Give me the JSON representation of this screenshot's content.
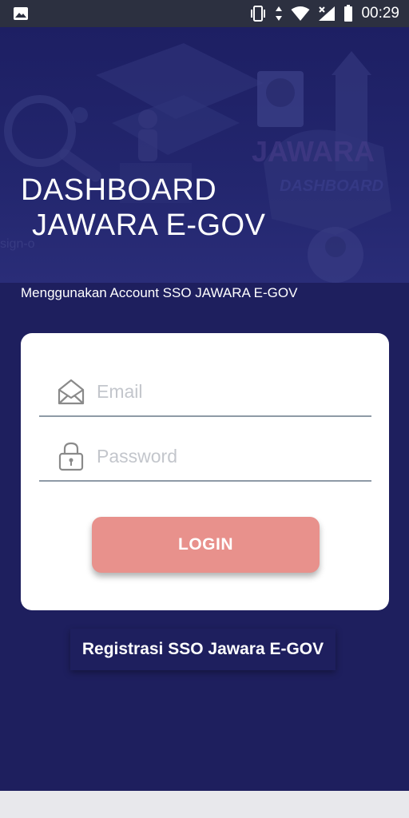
{
  "status_bar": {
    "time": "00:29",
    "icons": [
      "image-notification-icon",
      "vibrate-icon",
      "data-arrows-icon",
      "wifi-icon",
      "signal-icon",
      "battery-icon"
    ]
  },
  "hero": {
    "title_line1": "DASHBOARD",
    "title_line2": "JAWARA E-GOV",
    "background_art": [
      "magnifier-illustration",
      "building-illustration",
      "person-avatar-illustration",
      "jawara-dashboard-logo"
    ]
  },
  "subtitle": "Menggunakan Account SSO JAWARA E-GOV",
  "login_form": {
    "email_placeholder": "Email",
    "email_value": "",
    "email_icon": "envelope-icon",
    "password_placeholder": "Password",
    "password_value": "",
    "password_icon": "lock-icon",
    "login_label": "LOGIN"
  },
  "register_label": "Registrasi SSO Jawara E-GOV",
  "colors": {
    "background": "#1e1f5e",
    "login_button": "#e8918c",
    "card": "#ffffff",
    "status_bar": "#2c3040"
  }
}
